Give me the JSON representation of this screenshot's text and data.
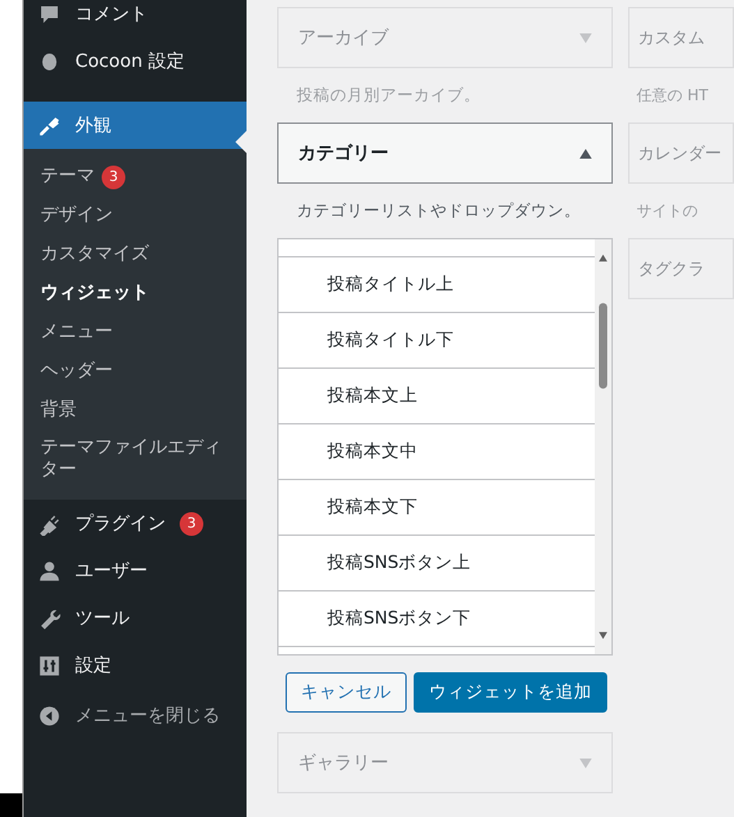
{
  "admin_menu": {
    "top_items": [
      {
        "label": "コメント",
        "kind": "comment",
        "selected": false
      },
      {
        "label": "Cocoon 設定",
        "kind": "circle",
        "selected": false
      }
    ],
    "current": {
      "label": "外観",
      "kind": "brush",
      "selected": true,
      "submenu": [
        {
          "label": "テーマ",
          "selected": false,
          "badge": "3"
        },
        {
          "label": "デザイン",
          "selected": false
        },
        {
          "label": "カスタマイズ",
          "selected": false
        },
        {
          "label": "ウィジェット",
          "selected": true
        },
        {
          "label": "メニュー",
          "selected": false
        },
        {
          "label": "ヘッダー",
          "selected": false
        },
        {
          "label": "背景",
          "selected": false
        },
        {
          "label": "テーマファイルエディター",
          "selected": false
        }
      ]
    },
    "bottom_items": [
      {
        "label": "プラグイン",
        "kind": "plug",
        "badge": "3",
        "selected": false
      },
      {
        "label": "ユーザー",
        "kind": "user",
        "selected": false
      },
      {
        "label": "ツール",
        "kind": "wrench",
        "selected": false
      },
      {
        "label": "設定",
        "kind": "settings",
        "selected": false
      }
    ],
    "collapse": "メニューを閉じる"
  },
  "widgets_left": [
    {
      "title": "アーカイブ",
      "description": "投稿の月別アーカイブ。",
      "expanded": false
    },
    {
      "title": "カテゴリー",
      "description": "カテゴリーリストやドロップダウン。",
      "expanded": true,
      "areas": [
        "投稿タイトル上",
        "投稿タイトル下",
        "投稿本文上",
        "投稿本文中",
        "投稿本文下",
        "投稿SNSボタン上",
        "投稿SNSボタン下"
      ],
      "buttons": {
        "cancel": "キャンセル",
        "add": "ウィジェットを追加"
      }
    },
    {
      "title": "ギャラリー",
      "expanded": false
    }
  ],
  "widgets_right": [
    {
      "title": "カスタム",
      "description": "任意の HT"
    },
    {
      "title": "カレンダー",
      "description": "サイトの"
    },
    {
      "title": "タグクラ"
    }
  ]
}
